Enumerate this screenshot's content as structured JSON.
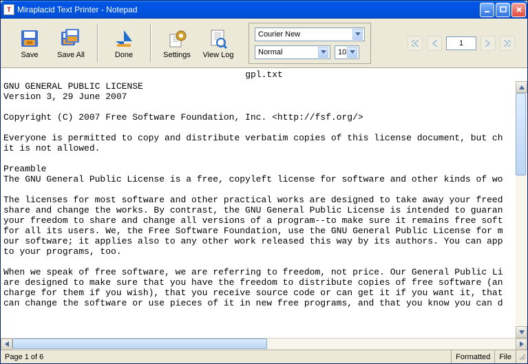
{
  "window": {
    "title": "Miraplacid Text Printer - Notepad"
  },
  "toolbar": {
    "save": "Save",
    "save_all": "Save All",
    "done": "Done",
    "settings": "Settings",
    "view_log": "View Log"
  },
  "font_panel": {
    "family": "Courier New",
    "style": "Normal",
    "size": "10"
  },
  "pager": {
    "current": "1"
  },
  "document": {
    "filename": "gpl.txt",
    "text": "GNU GENERAL PUBLIC LICENSE\nVersion 3, 29 June 2007\n\nCopyright (C) 2007 Free Software Foundation, Inc. <http://fsf.org/>\n\nEveryone is permitted to copy and distribute verbatim copies of this license document, but ch\nit is not allowed.\n\nPreamble\nThe GNU General Public License is a free, copyleft license for software and other kinds of wo\n\nThe licenses for most software and other practical works are designed to take away your freed\nshare and change the works. By contrast, the GNU General Public License is intended to guaran\nyour freedom to share and change all versions of a program--to make sure it remains free soft\nfor all its users. We, the Free Software Foundation, use the GNU General Public License for m\nour software; it applies also to any other work released this way by its authors. You can app\nto your programs, too.\n\nWhen we speak of free software, we are referring to freedom, not price. Our General Public Li\nare designed to make sure that you have the freedom to distribute copies of free software (an\ncharge for them if you wish), that you receive source code or can get it if you want it, that\ncan change the software or use pieces of it in new free programs, and that you know you can d"
  },
  "status": {
    "page": "Page 1 of 6",
    "formatted": "Formatted",
    "file": "File"
  }
}
